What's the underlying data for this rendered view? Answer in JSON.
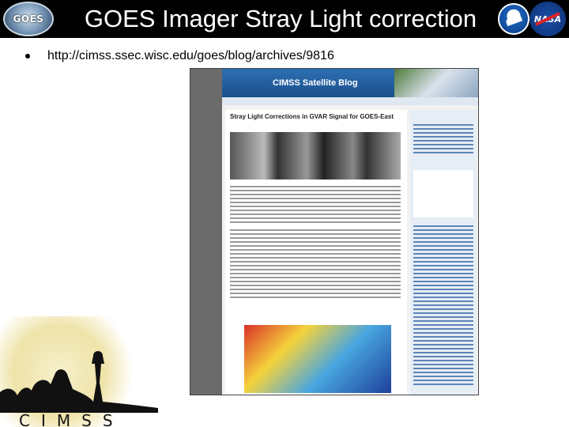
{
  "slide": {
    "title": "GOES Imager Stray Light correction",
    "bullet_link": "http://cimss.ssec.wisc.edu/goes/blog/archives/9816"
  },
  "logos": {
    "goes": "GOES",
    "nasa": "NASA",
    "cimss": "CIMSS"
  },
  "blog": {
    "site_name": "CIMSS Satellite Blog",
    "post_title": "Stray Light Corrections in GVAR Signal for GOES-East"
  },
  "colors": {
    "title_bar": "#000000",
    "blog_header": "#2e6fb3"
  }
}
